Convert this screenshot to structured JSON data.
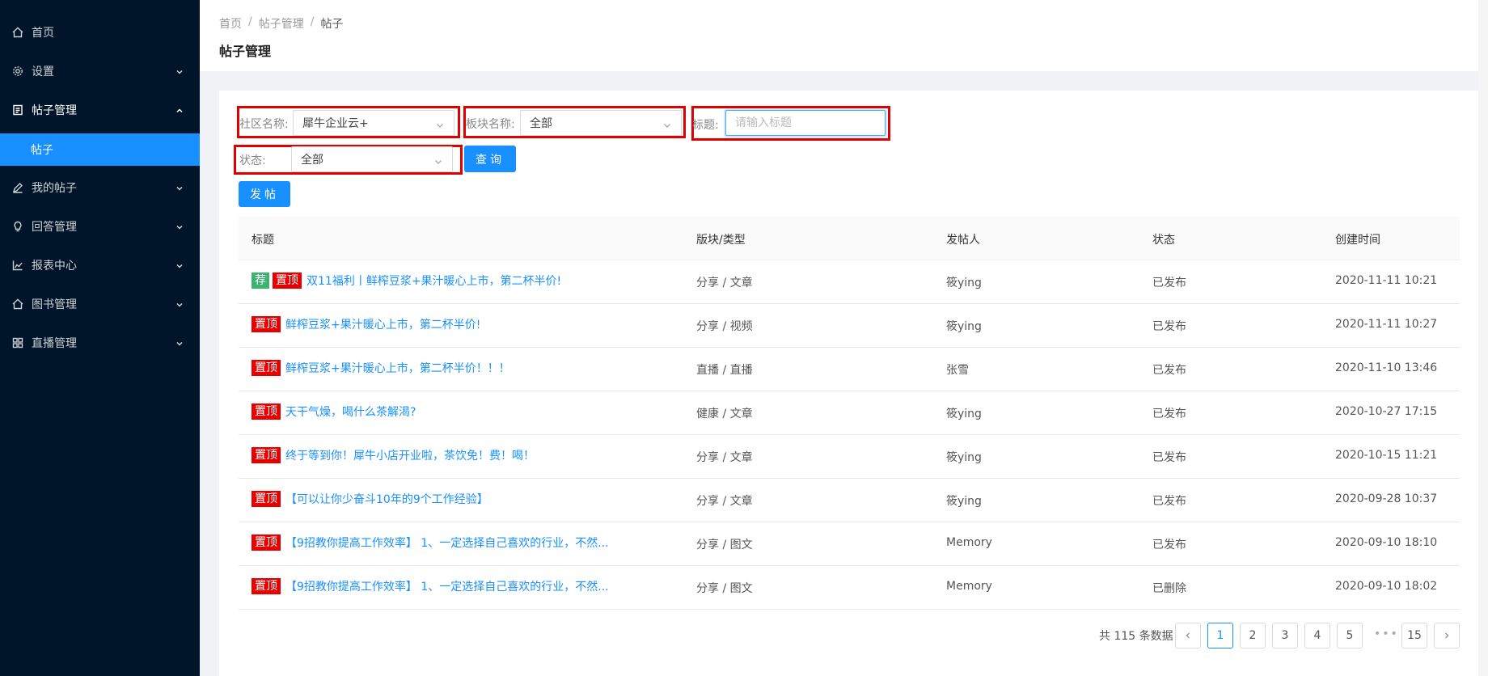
{
  "sidebar": {
    "items": [
      {
        "label": "首页",
        "icon": "home-icon"
      },
      {
        "label": "设置",
        "icon": "gear-icon"
      },
      {
        "label": "帖子管理",
        "icon": "file-icon"
      },
      {
        "label": "我的帖子",
        "icon": "edit-icon"
      },
      {
        "label": "回答管理",
        "icon": "bulb-icon"
      },
      {
        "label": "报表中心",
        "icon": "line-chart-icon"
      },
      {
        "label": "图书管理",
        "icon": "home-icon"
      },
      {
        "label": "直播管理",
        "icon": "appstore-icon"
      }
    ],
    "sub_active": "帖子"
  },
  "header": {
    "breadcrumb": [
      "首页",
      "帖子管理",
      "帖子"
    ],
    "separator": "/",
    "title": "帖子管理"
  },
  "filters": {
    "community_label": "社区名称:",
    "community_value": "犀牛企业云+",
    "board_label": "板块名称:",
    "board_value": "全部",
    "title_label": "标题:",
    "title_placeholder": "请输入标题",
    "title_value": "",
    "status_label": "状态:",
    "status_value": "全部",
    "query_label": "查询",
    "post_label": "发帖"
  },
  "table": {
    "columns": [
      "标题",
      "版块/类型",
      "发帖人",
      "状态",
      "创建时间"
    ],
    "rows": [
      {
        "tags": [
          "荐",
          "置顶"
        ],
        "title": "双11福利丨鲜榨豆浆+果汁暖心上市，第二杯半价!",
        "type": "分享 / 文章",
        "author": "筱ying",
        "status": "已发布",
        "time": "2020-11-11 10:21"
      },
      {
        "tags": [
          "置顶"
        ],
        "title": "鲜榨豆浆+果汁暖心上市，第二杯半价!",
        "type": "分享 / 视频",
        "author": "筱ying",
        "status": "已发布",
        "time": "2020-11-11 10:27"
      },
      {
        "tags": [
          "置顶"
        ],
        "title": "鲜榨豆浆+果汁暖心上市，第二杯半价！！！",
        "type": "直播 / 直播",
        "author": "张雪",
        "status": "已发布",
        "time": "2020-11-10 13:46"
      },
      {
        "tags": [
          "置顶"
        ],
        "title": "天干气燥，喝什么茶解渴?",
        "type": "健康 / 文章",
        "author": "筱ying",
        "status": "已发布",
        "time": "2020-10-27 17:15"
      },
      {
        "tags": [
          "置顶"
        ],
        "title": "终于等到你！犀牛小店开业啦，茶饮免！费！喝！",
        "type": "分享 / 文章",
        "author": "筱ying",
        "status": "已发布",
        "time": "2020-10-15 11:21"
      },
      {
        "tags": [
          "置顶"
        ],
        "title": "【可以让你少奋斗10年的9个工作经验】",
        "type": "分享 / 文章",
        "author": "筱ying",
        "status": "已发布",
        "time": "2020-09-28 10:37"
      },
      {
        "tags": [
          "置顶"
        ],
        "title": "【9招教你提高工作效率】 1、一定选择自己喜欢的行业，不然...",
        "type": "分享 / 图文",
        "author": "Memory",
        "status": "已发布",
        "time": "2020-09-10 18:10"
      },
      {
        "tags": [
          "置顶"
        ],
        "title": "【9招教你提高工作效率】 1、一定选择自己喜欢的行业，不然...",
        "type": "分享 / 图文",
        "author": "Memory",
        "status": "已删除",
        "time": "2020-09-10 18:02"
      }
    ]
  },
  "pagination": {
    "total_text": "共 115 条数据",
    "pages": [
      "1",
      "2",
      "3",
      "4",
      "5"
    ],
    "ellipsis": "•••",
    "last": "15",
    "current": "1"
  },
  "colors": {
    "sidebar_bg": "#001529",
    "primary": "#1890ff",
    "tag_top": "#e80000",
    "tag_recommend": "#3cb371",
    "highlight_box": "#e00000"
  }
}
